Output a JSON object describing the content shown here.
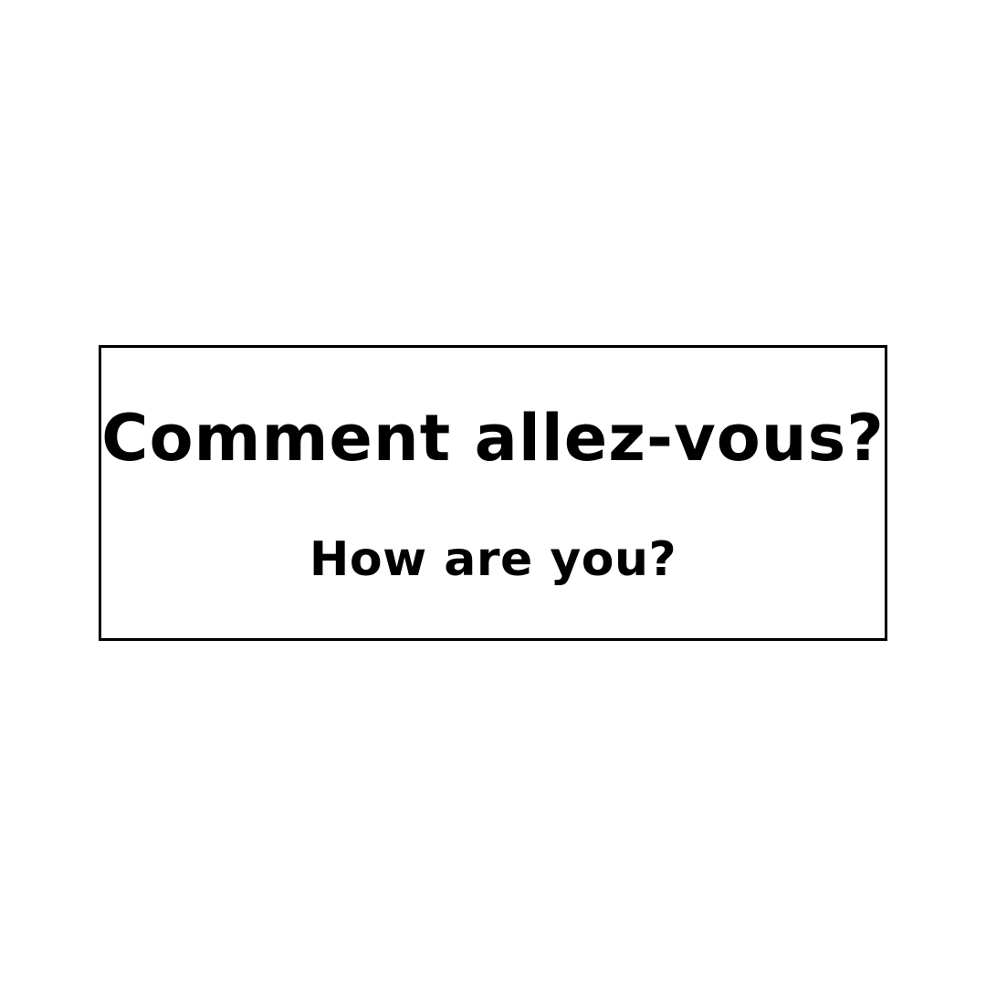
{
  "card": {
    "french_phrase": "Comment allez-vous?",
    "english_translation": "How are you?"
  },
  "colors": {
    "background": "#ffffff",
    "text": "#000000",
    "border": "#000000"
  }
}
